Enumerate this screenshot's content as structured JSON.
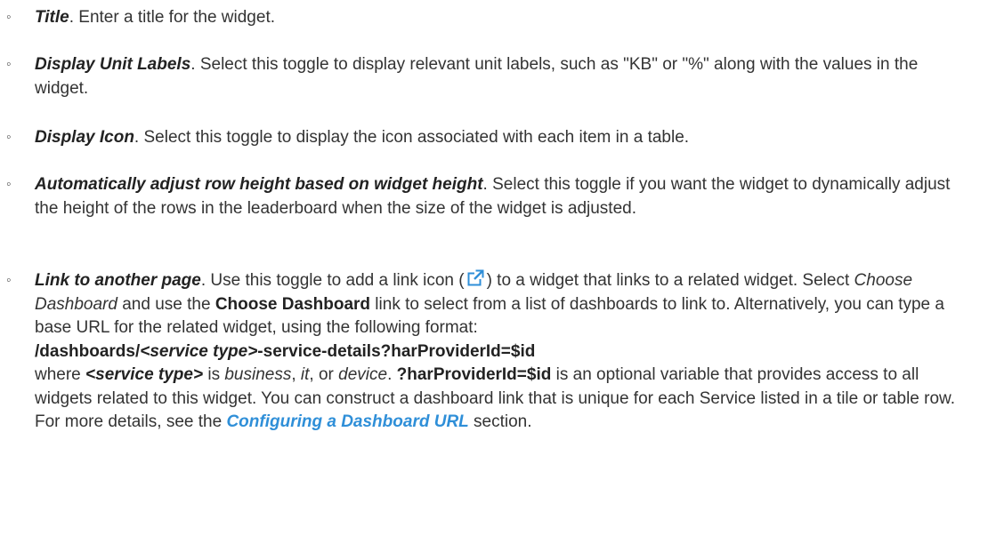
{
  "items": [
    {
      "term": "Title",
      "text": ". Enter a title for the widget."
    },
    {
      "term": "Display Unit Labels",
      "text": ". Select this toggle to display relevant unit labels, such as \"KB\" or \"%\" along with the values in the widget."
    },
    {
      "term": "Display Icon",
      "text": ". Select this toggle to display the icon associated with each item in a table."
    },
    {
      "term": "Automatically adjust row height based on widget height",
      "text": ". Select this toggle if you want the widget to dynamically adjust the height of the rows in the leaderboard when the size of the widget is adjusted."
    },
    {
      "term": "Link to another page",
      "text_a": ". Use this toggle to add a link icon (",
      "text_b": ") to a widget that links to a related widget. Select ",
      "choose_dashboard_italic": "Choose Dashboard",
      "text_c": " and use the ",
      "choose_dashboard_bold": "Choose Dashboard",
      "text_d": " link to select from a list of dashboards to link to. Alternatively, you can type a base URL for the related widget, using the following format:",
      "code_prefix": "/dashboards/",
      "code_placeholder": "<service type>",
      "code_suffix": "-service-details?harProviderId=$id",
      "where": "where ",
      "placeholder_ref": "<service type>",
      "is": " is ",
      "opt_business": "business",
      "comma1": ", ",
      "opt_it": "it",
      "comma_or": ", or ",
      "opt_device": "device",
      "period": ". ",
      "var_name": "?harProviderId=$id",
      "text_e": " is an optional variable that provides access to all widgets related to this widget. You can construct a dashboard link that is unique for each Service listed in a tile or table row. For more details, see the ",
      "link_label": "Configuring a Dashboard URL",
      "text_f": " section."
    }
  ],
  "icons": {
    "bullet": "◦",
    "external_link": "external-link-icon"
  },
  "colors": {
    "text": "#333333",
    "link": "#2f8fd8",
    "icon": "#2f8fd8"
  }
}
